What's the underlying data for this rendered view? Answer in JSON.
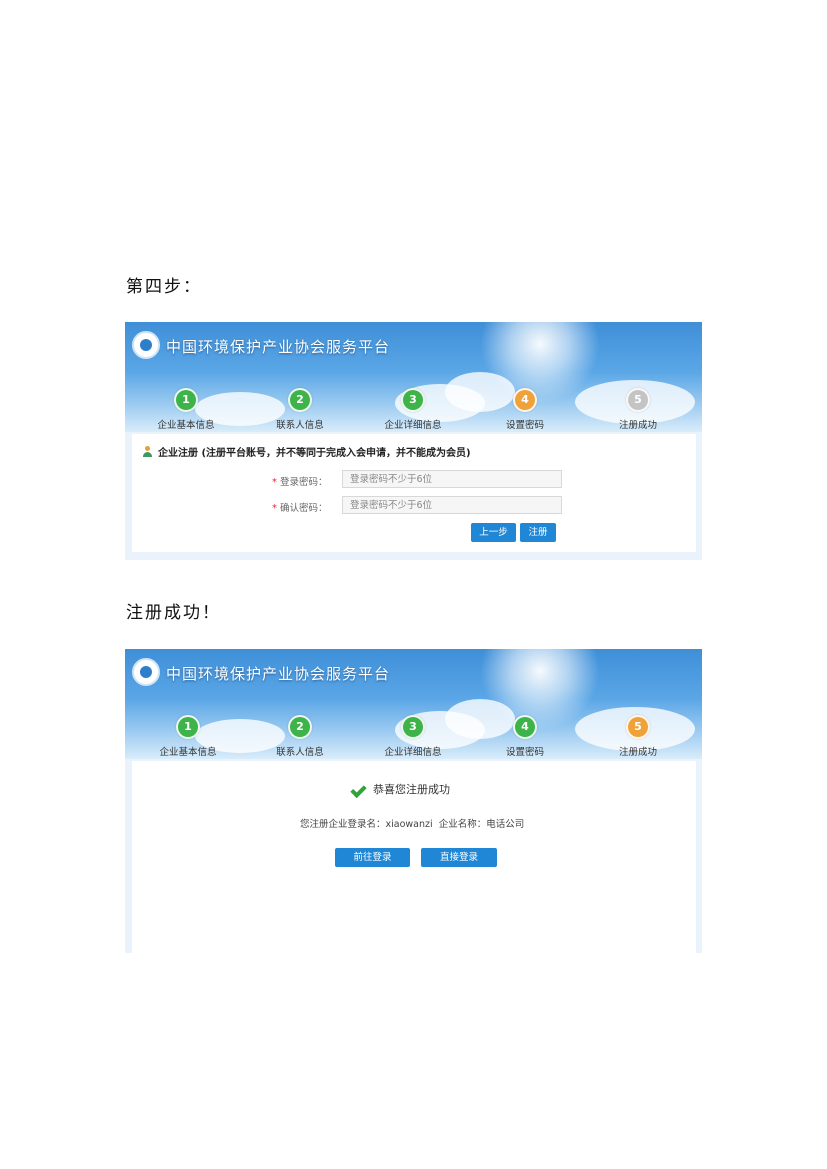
{
  "doc": {
    "heading_step4": "第四步：",
    "heading_success": "注册成功！"
  },
  "site": {
    "title": "中国环境保护产业协会服务平台"
  },
  "steps": [
    {
      "num": "1",
      "label": "企业基本信息"
    },
    {
      "num": "2",
      "label": "联系人信息"
    },
    {
      "num": "3",
      "label": "企业详细信息"
    },
    {
      "num": "4",
      "label": "设置密码"
    },
    {
      "num": "5",
      "label": "注册成功"
    }
  ],
  "colors": {
    "step_done": "#3db34a",
    "step_current": "#f0a23a",
    "step_pending": "#c4c4c4",
    "button": "#1f87d6"
  },
  "form": {
    "section_title": "企业注册",
    "section_note": "(注册平台账号，并不等同于完成入会申请，并不能成为会员)",
    "password_label": "登录密码：",
    "password_placeholder": "登录密码不少于6位",
    "confirm_label": "确认密码：",
    "confirm_placeholder": "登录密码不少于6位",
    "required_mark": "*",
    "prev_button": "上一步",
    "register_button": "注册"
  },
  "success": {
    "message": "恭喜您注册成功",
    "login_name_label": "您注册企业登录名：",
    "login_name": "xiaowanzi",
    "company_label": "企业名称：",
    "company_name": "电话公司",
    "goto_login_button": "前往登录",
    "direct_login_button": "直接登录"
  }
}
